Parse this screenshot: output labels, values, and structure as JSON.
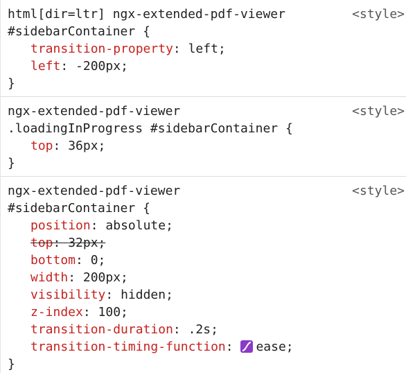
{
  "rules": [
    {
      "selector_lines": [
        "html[dir=ltr] ngx-extended-pdf-viewer",
        "#sidebarContainer {"
      ],
      "source": "<style>",
      "declarations": [
        {
          "prop": "transition-property",
          "value": "left;"
        },
        {
          "prop": "left",
          "value": "-200px;"
        }
      ],
      "close": "}"
    },
    {
      "selector_lines": [
        "ngx-extended-pdf-viewer",
        ".loadingInProgress #sidebarContainer {"
      ],
      "source": "<style>",
      "declarations": [
        {
          "prop": "top",
          "value": "36px;"
        }
      ],
      "close": "}"
    },
    {
      "selector_lines": [
        "ngx-extended-pdf-viewer",
        "#sidebarContainer {"
      ],
      "source": "<style>",
      "declarations": [
        {
          "prop": "position",
          "value": "absolute;"
        },
        {
          "prop": "top",
          "value": "32px;",
          "overridden": true
        },
        {
          "prop": "bottom",
          "value": "0;"
        },
        {
          "prop": "width",
          "value": "200px;"
        },
        {
          "prop": "visibility",
          "value": "hidden;"
        },
        {
          "prop": "z-index",
          "value": "100;"
        },
        {
          "prop": "transition-duration",
          "value": ".2s;"
        },
        {
          "prop": "transition-timing-function",
          "value": "ease;",
          "swatch_icon": "easing-curve-icon"
        }
      ],
      "close": "}"
    }
  ]
}
